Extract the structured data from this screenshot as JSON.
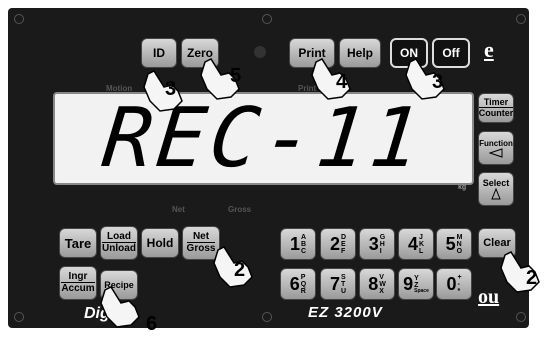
{
  "top_buttons": {
    "id": "ID",
    "zero": "Zero",
    "print": "Print",
    "help": "Help",
    "on": "ON",
    "off": "Off",
    "e_label": "e"
  },
  "indicators": {
    "motion": "Motion",
    "print": "Print",
    "net": "Net",
    "gross": "Gross",
    "kg": "kg"
  },
  "display": {
    "reading": "REC-11"
  },
  "side_buttons": {
    "timer_counter": {
      "top": "Timer",
      "bottom": "Counter"
    },
    "function": "Function",
    "select": "Select"
  },
  "left_buttons": {
    "tare": "Tare",
    "load_unload": {
      "top": "Load",
      "bottom": "Unload"
    },
    "hold": "Hold",
    "net_gross": {
      "top": "Net",
      "bottom": "Gross"
    },
    "ingr_accum": {
      "top": "Ingr",
      "bottom": "Accum"
    },
    "recipe": "Recipe"
  },
  "keypad": [
    {
      "digit": "1",
      "letters": [
        "A",
        "B",
        "C"
      ]
    },
    {
      "digit": "2",
      "letters": [
        "D",
        "E",
        "F"
      ]
    },
    {
      "digit": "3",
      "letters": [
        "G",
        "H",
        "I"
      ]
    },
    {
      "digit": "4",
      "letters": [
        "J",
        "K",
        "L"
      ]
    },
    {
      "digit": "5",
      "letters": [
        "M",
        "N",
        "O"
      ]
    },
    {
      "digit": "6",
      "letters": [
        "P",
        "Q",
        "R"
      ]
    },
    {
      "digit": "7",
      "letters": [
        "S",
        "T",
        "U"
      ]
    },
    {
      "digit": "8",
      "letters": [
        "V",
        "W",
        "X"
      ]
    },
    {
      "digit": "9",
      "letters": [
        "Y",
        "Z",
        "Space"
      ]
    },
    {
      "digit": "0",
      "letters": [
        "+",
        "-",
        "*"
      ]
    }
  ],
  "clear": "Clear",
  "brand": {
    "logo": "Digi",
    "model": "EZ 3200V",
    "ou": "ou"
  },
  "callouts": [
    "3",
    "5",
    "4",
    "3",
    "2",
    "6",
    "2"
  ]
}
